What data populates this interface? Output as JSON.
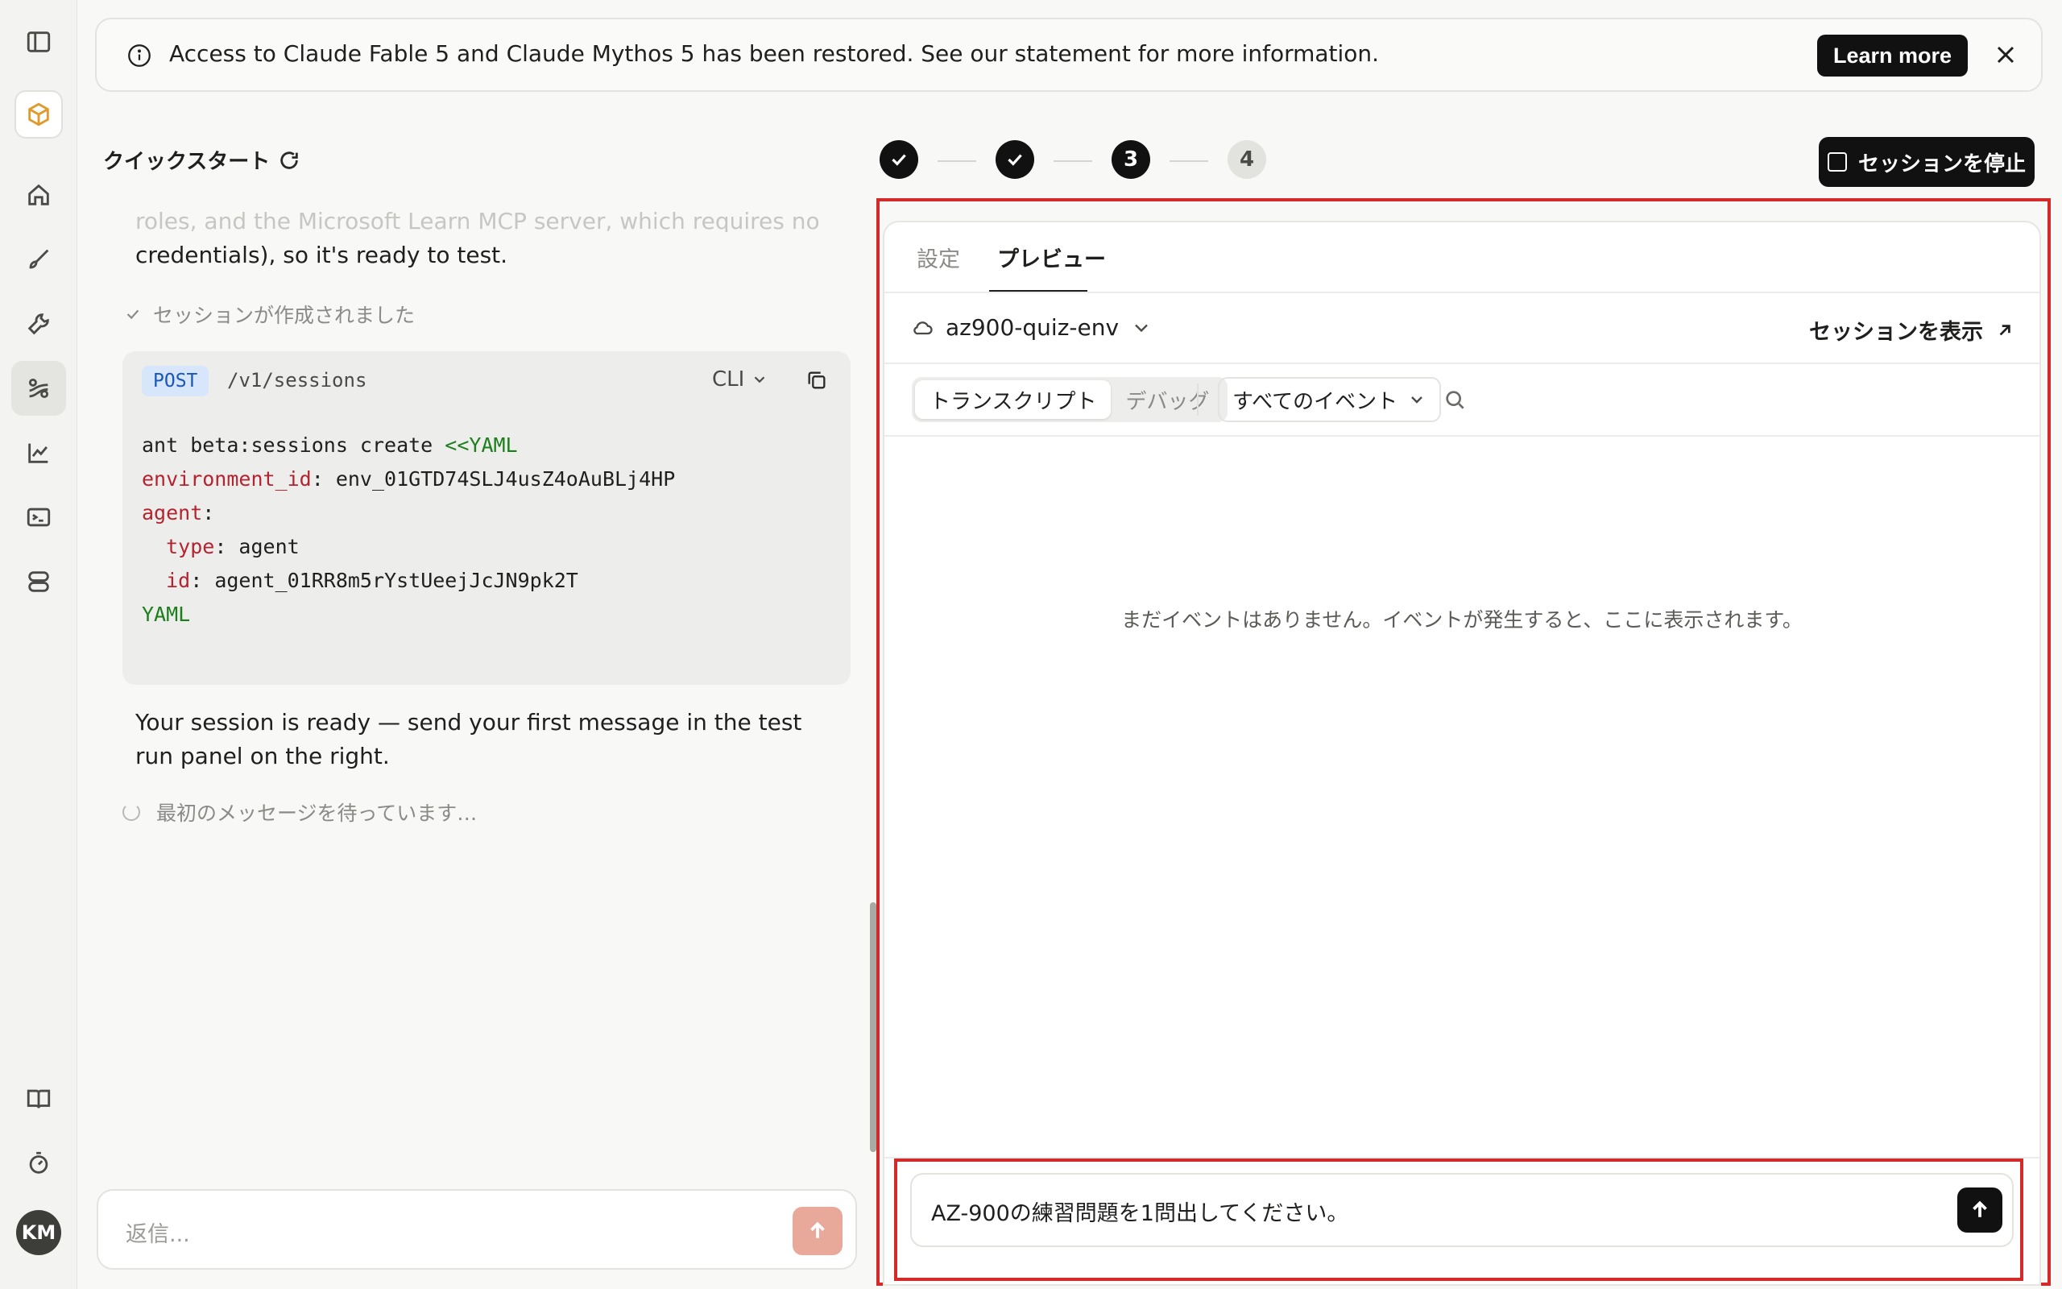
{
  "banner": {
    "text": "Access to Claude Fable 5 and Claude Mythos 5 has been restored. See our statement for more information.",
    "learn_more": "Learn more"
  },
  "sidebar": {
    "items": [
      "sidebar-toggle",
      "project",
      "home",
      "build",
      "tools",
      "sessions",
      "analytics",
      "console",
      "apps",
      "docs",
      "timer"
    ],
    "avatar_initials": "KM"
  },
  "quickstart": {
    "title": "クイックスタート",
    "faded_line": "roles, and the Microsoft Learn MCP server, which requires no",
    "para1": "credentials), so it's ready to test.",
    "session_created": "セッションが作成されました",
    "code": {
      "method": "POST",
      "endpoint": "/v1/sessions",
      "lang": "CLI",
      "line1_cmd": "ant beta:sessions create ",
      "line1_heredoc": "<<YAML",
      "env_key": "environment_id",
      "env_val": ": env_01GTD74SLJ4usZ4oAuBLj4HP",
      "agent_key": "agent",
      "agent_colon": ":",
      "type_key": "  type",
      "type_val": ": agent",
      "id_key": "  id",
      "id_val": ": agent_01RR8m5rYstUeejJcJN9pk2T",
      "end": "YAML"
    },
    "para2": "Your session is ready — send your first message in the test run panel on the right.",
    "waiting": "最初のメッセージを待っています…",
    "reply_placeholder": "返信..."
  },
  "stepper": {
    "current": "3",
    "next": "4"
  },
  "stop_session": "セッションを停止",
  "panel": {
    "tabs": [
      "設定",
      "プレビュー"
    ],
    "environment": "az900-quiz-env",
    "view_session": "セッションを表示",
    "segments": [
      "トランスクリプト",
      "デバッグ"
    ],
    "events_filter": "すべてのイベント",
    "empty": "まだイベントはありません。イベントが発生すると、ここに表示されます。",
    "message": "AZ-900の練習問題を1問出してください。"
  }
}
